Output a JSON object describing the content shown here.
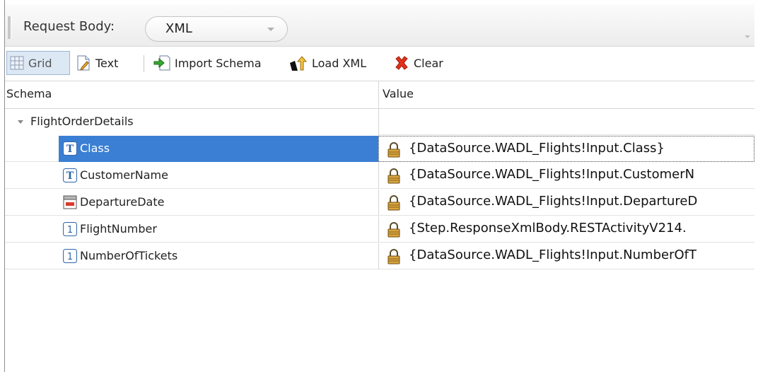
{
  "request_body": {
    "label": "Request Body:",
    "selected": "XML"
  },
  "toolbar": {
    "grid": "Grid",
    "text": "Text",
    "import_schema": "Import Schema",
    "load_xml": "Load XML",
    "clear": "Clear"
  },
  "grid": {
    "columns": {
      "schema": "Schema",
      "value": "Value"
    },
    "root": {
      "label": "FlightOrderDetails"
    },
    "rows": [
      {
        "name": "Class",
        "type_icon": "text-type-icon",
        "value": "{DataSource.WADL_Flights!Input.Class}"
      },
      {
        "name": "CustomerName",
        "type_icon": "text-type-icon",
        "value": "{DataSource.WADL_Flights!Input.CustomerN"
      },
      {
        "name": "DepartureDate",
        "type_icon": "date-type-icon",
        "value": "{DataSource.WADL_Flights!Input.DepartureD"
      },
      {
        "name": "FlightNumber",
        "type_icon": "number-type-icon",
        "value": "{Step.ResponseXmlBody.RESTActivityV214."
      },
      {
        "name": "NumberOfTickets",
        "type_icon": "number-type-icon",
        "value": "{DataSource.WADL_Flights!Input.NumberOfT"
      }
    ],
    "selected_row": "Class"
  },
  "colors": {
    "selection": "#3a7fd3",
    "toolbar_active": "#dde8f5"
  }
}
